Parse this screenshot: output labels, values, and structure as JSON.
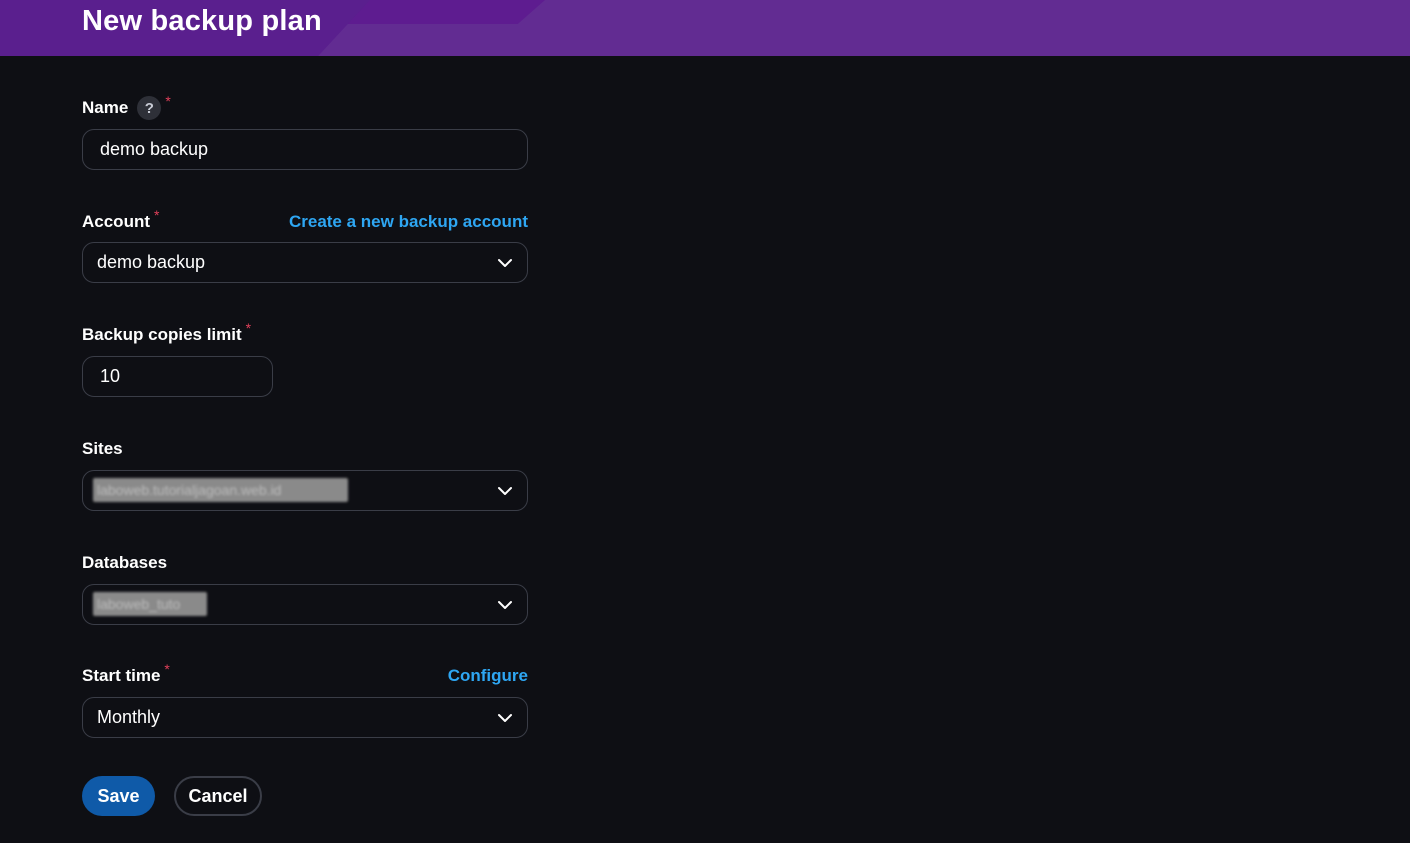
{
  "header": {
    "title": "New backup plan"
  },
  "form": {
    "name": {
      "label": "Name",
      "help": "?",
      "required": "*",
      "value": "demo backup"
    },
    "account": {
      "label": "Account",
      "required": "*",
      "link": "Create a new backup account",
      "value": "demo backup"
    },
    "copies": {
      "label": "Backup copies limit",
      "required": "*",
      "value": "10"
    },
    "sites": {
      "label": "Sites",
      "value": "laboweb.tutorialjagoan.web.id"
    },
    "databases": {
      "label": "Databases",
      "value": "laboweb_tuto"
    },
    "start_time": {
      "label": "Start time",
      "required": "*",
      "link": "Configure",
      "value": "Monthly"
    }
  },
  "actions": {
    "save": "Save",
    "cancel": "Cancel"
  },
  "icons": {
    "dropdown": "chevron-down-icon",
    "help": "question-icon"
  },
  "colors": {
    "accent_link": "#2ea6f2",
    "primary_button": "#0f5aa8",
    "header": "#622c92",
    "required": "#e0405a"
  }
}
